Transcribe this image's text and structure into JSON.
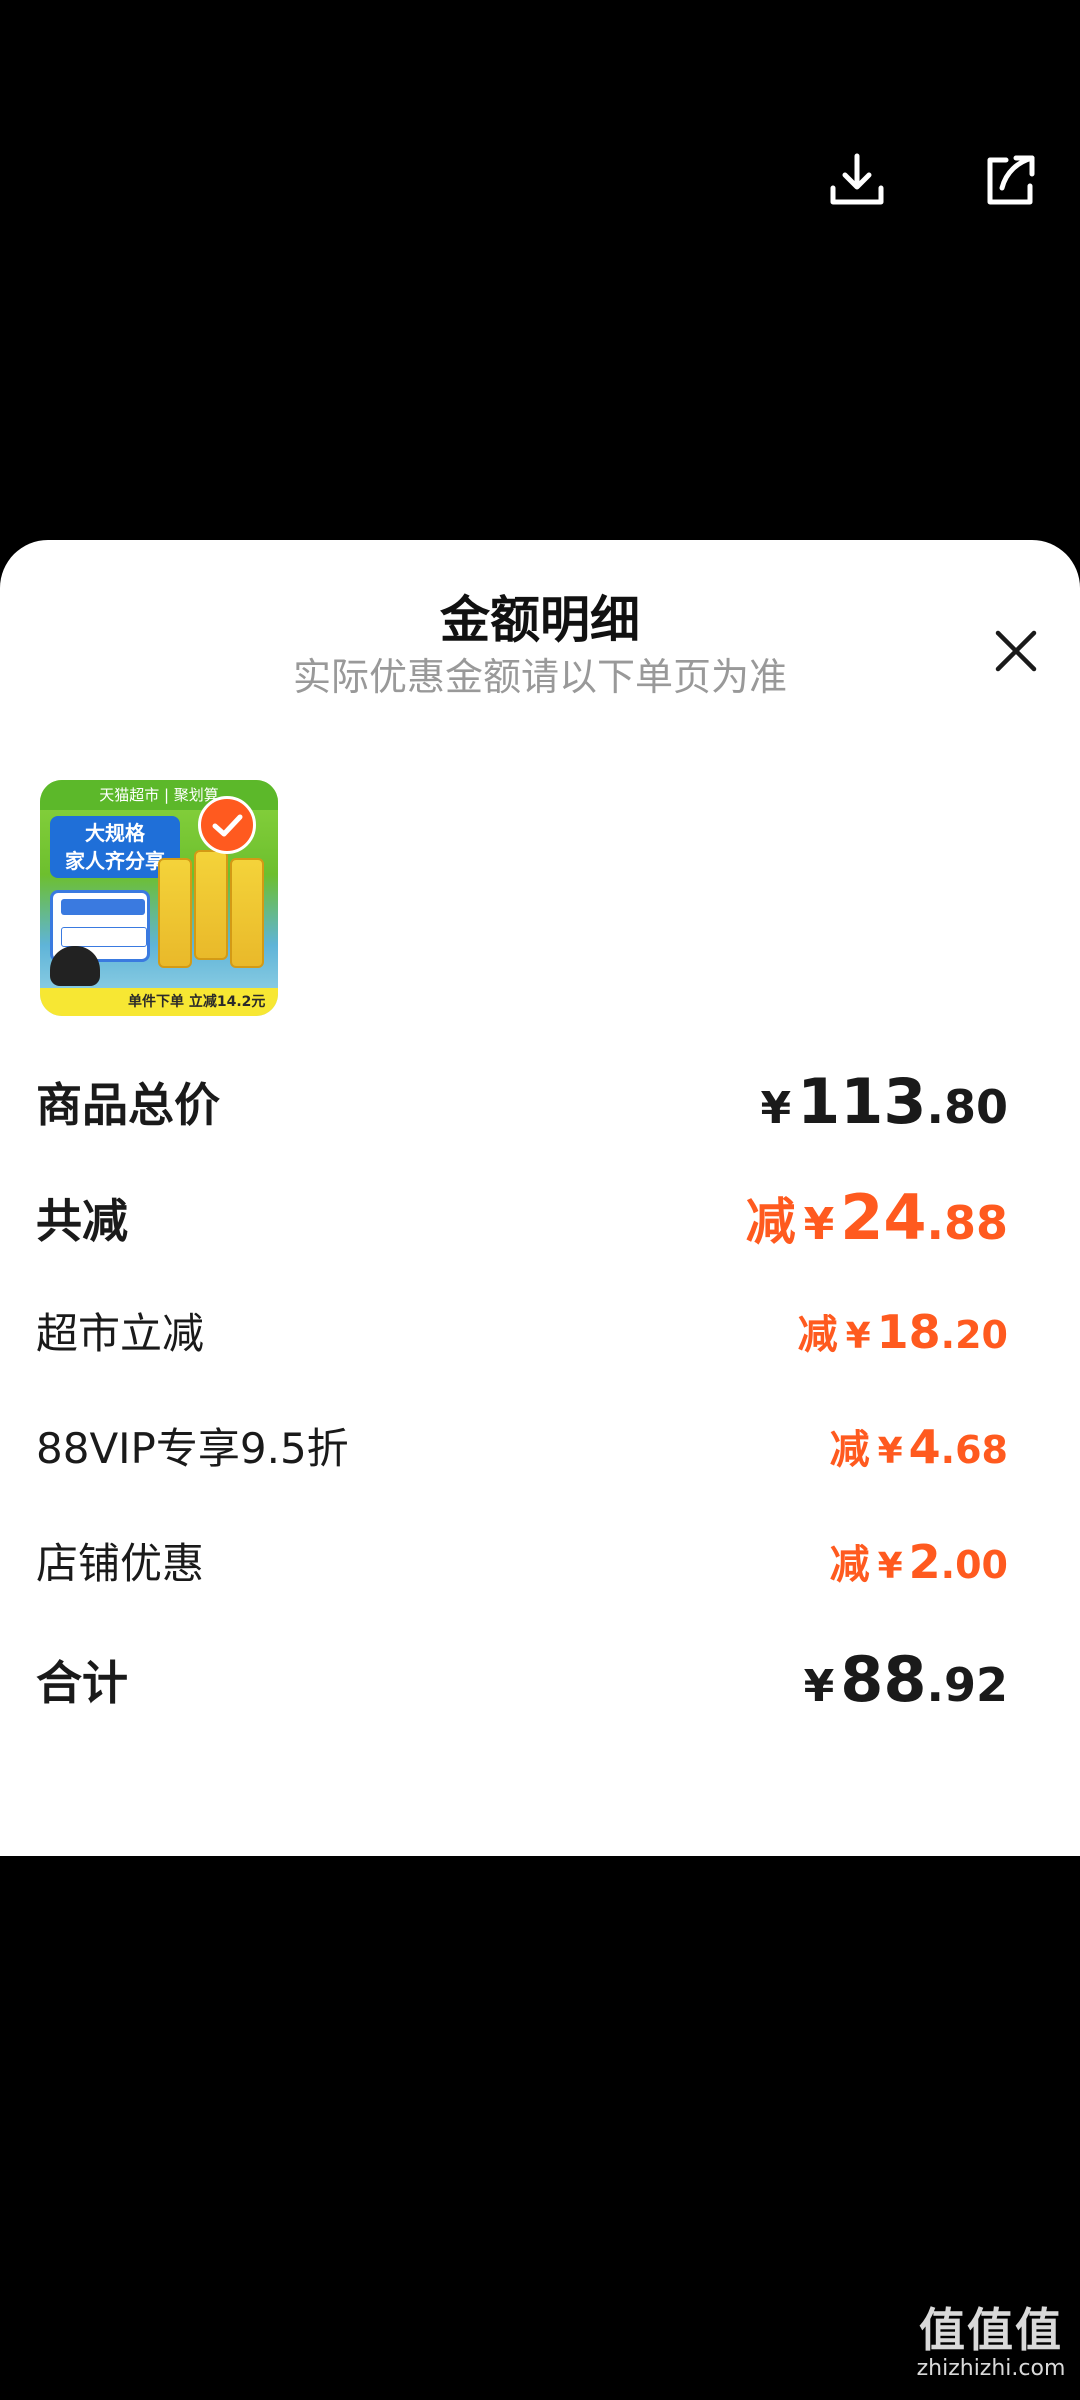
{
  "header": {
    "download_icon": "download-icon",
    "share_icon": "share-icon"
  },
  "sheet": {
    "title": "金额明细",
    "subtitle": "实际优惠金额请以下单页为准",
    "close_icon": "close-icon"
  },
  "product": {
    "thumb_header": "天猫超市 | 聚划算",
    "thumb_banner": "大规格\n家人齐分享",
    "thumb_footer": "单件下单 立减14.2元",
    "selected": true,
    "check_icon": "check-icon"
  },
  "rows": [
    {
      "label": "商品总价",
      "prefix": "",
      "yen": "¥",
      "int": "113",
      "dec": ".80"
    },
    {
      "label": "共减",
      "prefix": "减",
      "yen": "¥",
      "int": "24",
      "dec": ".88"
    },
    {
      "label": "超市立减",
      "prefix": "减",
      "yen": "¥",
      "int": "18",
      "dec": ".20"
    },
    {
      "label": "88VIP专享9.5折",
      "prefix": "减",
      "yen": "¥",
      "int": "4",
      "dec": ".68"
    },
    {
      "label": "店铺优惠",
      "prefix": "减",
      "yen": "¥",
      "int": "2",
      "dec": ".00"
    },
    {
      "label": "合计",
      "prefix": "",
      "yen": "¥",
      "int": "88",
      "dec": ".92"
    }
  ],
  "colors": {
    "accent": "#ff5a1f",
    "text": "#1a1a1a",
    "subtle": "#999999"
  },
  "watermark": {
    "main": "值值值",
    "sub": "zhizhizhi.com"
  }
}
